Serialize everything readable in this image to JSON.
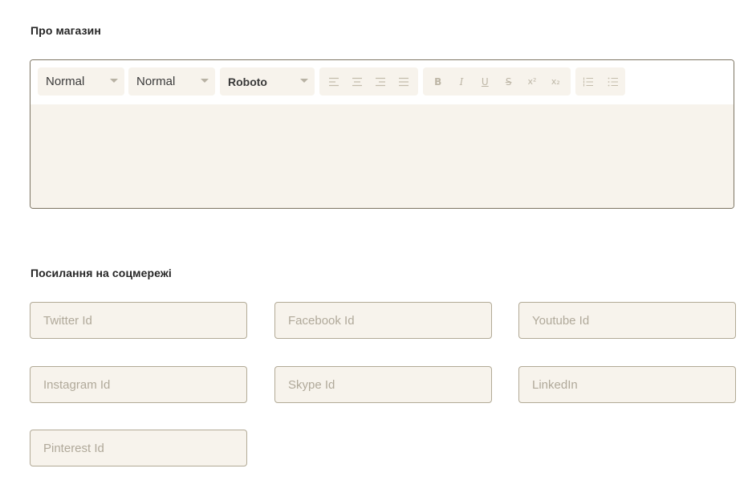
{
  "about": {
    "title": "Про магазин",
    "toolbar": {
      "header_select": "Normal",
      "size_select": "Normal",
      "font_select": "Roboto",
      "align_buttons": [
        "align-left-icon",
        "align-center-icon",
        "align-right-icon",
        "align-justify-icon"
      ],
      "format_buttons": [
        "B",
        "I",
        "U",
        "S",
        "x²",
        "x₂"
      ],
      "list_buttons": [
        "ordered-list-icon",
        "bullet-list-icon"
      ]
    },
    "content": ""
  },
  "social": {
    "title": "Посилання на соцмережі",
    "fields": {
      "twitter": {
        "placeholder": "Twitter Id",
        "value": ""
      },
      "facebook": {
        "placeholder": "Facebook Id",
        "value": ""
      },
      "youtube": {
        "placeholder": "Youtube Id",
        "value": ""
      },
      "instagram": {
        "placeholder": "Instagram Id",
        "value": ""
      },
      "skype": {
        "placeholder": "Skype Id",
        "value": ""
      },
      "linkedin": {
        "placeholder": "LinkedIn",
        "value": ""
      },
      "pinterest": {
        "placeholder": "Pinterest Id",
        "value": ""
      }
    }
  },
  "colors": {
    "field_background": "#f7f3ec",
    "field_border": "#b2aa96",
    "editor_border": "#7d7563",
    "icon_color": "#c4bdac"
  }
}
